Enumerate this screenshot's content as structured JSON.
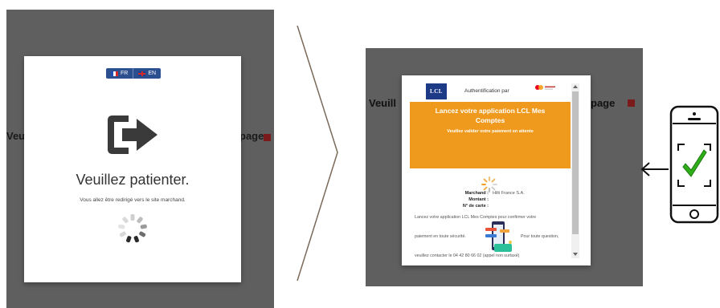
{
  "left": {
    "bg_text_left": "Veu",
    "bg_text_right": "page",
    "lang_fr": "FR",
    "lang_en": "EN",
    "title": "Veuillez patienter.",
    "subtitle": "Vous allez être redirigé vers le site marchand."
  },
  "right": {
    "bg_text_left": "Veuill",
    "bg_text_right": "page",
    "logo_text": "LCL",
    "auth_label": "Authentification par",
    "banner_title_line1": "Lancez votre application LCL Mes",
    "banner_title_line2": "Comptes",
    "banner_sub": "Veuillez valider votre paiement en attente",
    "merchant_label": "Marchand :",
    "merchant_value": "Hilti France S.A.",
    "amount_label": "Montant :",
    "card_label": "N° de carte :",
    "body_line1": "Lancez votre application LCL Mes Comptes pour confirmer votre",
    "body_line2a": "paiement en toute sécurité.",
    "body_line2b": "Pour toute question,",
    "body_line3": "veuillez contacter le 04 42 80 66 02 (appel non surtaxé)"
  },
  "colors": {
    "overlay": "#5f5f5f",
    "banner_orange": "#ef9a1d",
    "lcl_blue": "#1c3a85",
    "check_green": "#2fae1a"
  }
}
